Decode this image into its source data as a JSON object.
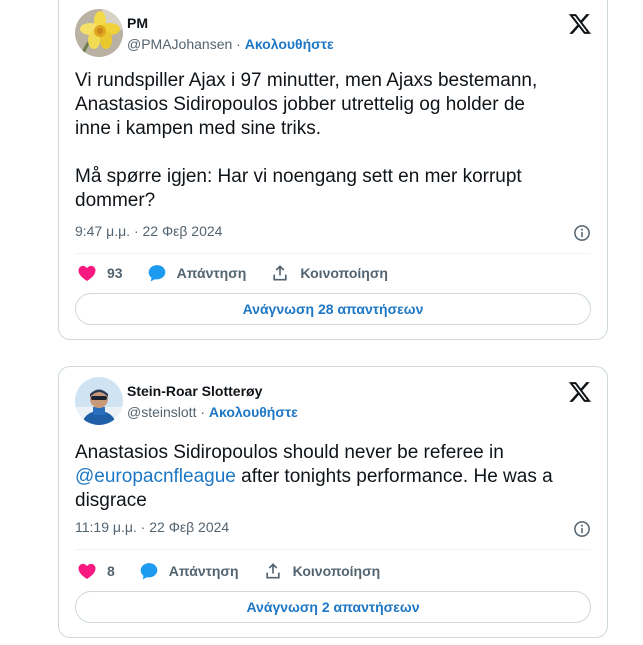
{
  "tweets": [
    {
      "author_name": "PM",
      "handle": "@PMAJohansen",
      "separator": "·",
      "follow_label": "Ακολουθήστε",
      "text": "Vi rundspiller Ajax i 97 minutter, men Ajaxs bestemann,\nAnastasios Sidiropoulos jobber utrettelig og holder de\ninne i kampen med sine triks.\n\nMå spørre igjen: Har vi noengang sett en mer korrupt\ndommer?",
      "timestamp": "9:47 μ.μ. · 22 Φεβ 2024",
      "like_count": "93",
      "reply_label": "Απάντηση",
      "share_label": "Κοινοποίηση",
      "read_replies_label": "Ανάγνωση 28 απαντήσεων",
      "avatar_icon": "daffodil-flower"
    },
    {
      "author_name": "Stein-Roar Slotterøy",
      "handle": "@steinslott",
      "separator": "·",
      "follow_label": "Ακολουθήστε",
      "text_before": "Anastasios Sidiropoulos should never be referee in\n",
      "mention": "@europacnfleague",
      "text_after": " after tonights performance. He was a\ndisgrace",
      "timestamp": "11:19 μ.μ. · 22 Φεβ 2024",
      "like_count": "8",
      "reply_label": "Απάντηση",
      "share_label": "Κοινοποίηση",
      "read_replies_label": "Ανάγνωση 2 απαντήσεων",
      "avatar_icon": "person-photo"
    }
  ],
  "colors": {
    "accent_blue": "#1d77c4",
    "like_pink": "#f91880",
    "reply_blue": "#1d9bf0",
    "muted_gray": "#536471",
    "border": "#cfd9de"
  }
}
